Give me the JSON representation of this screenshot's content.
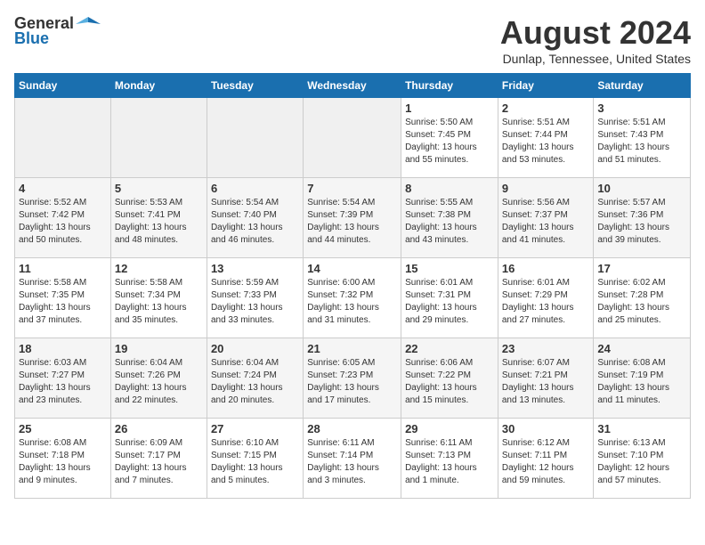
{
  "header": {
    "logo_general": "General",
    "logo_blue": "Blue",
    "month_year": "August 2024",
    "location": "Dunlap, Tennessee, United States"
  },
  "weekdays": [
    "Sunday",
    "Monday",
    "Tuesday",
    "Wednesday",
    "Thursday",
    "Friday",
    "Saturday"
  ],
  "weeks": [
    [
      {
        "day": "",
        "info": ""
      },
      {
        "day": "",
        "info": ""
      },
      {
        "day": "",
        "info": ""
      },
      {
        "day": "",
        "info": ""
      },
      {
        "day": "1",
        "info": "Sunrise: 5:50 AM\nSunset: 7:45 PM\nDaylight: 13 hours\nand 55 minutes."
      },
      {
        "day": "2",
        "info": "Sunrise: 5:51 AM\nSunset: 7:44 PM\nDaylight: 13 hours\nand 53 minutes."
      },
      {
        "day": "3",
        "info": "Sunrise: 5:51 AM\nSunset: 7:43 PM\nDaylight: 13 hours\nand 51 minutes."
      }
    ],
    [
      {
        "day": "4",
        "info": "Sunrise: 5:52 AM\nSunset: 7:42 PM\nDaylight: 13 hours\nand 50 minutes."
      },
      {
        "day": "5",
        "info": "Sunrise: 5:53 AM\nSunset: 7:41 PM\nDaylight: 13 hours\nand 48 minutes."
      },
      {
        "day": "6",
        "info": "Sunrise: 5:54 AM\nSunset: 7:40 PM\nDaylight: 13 hours\nand 46 minutes."
      },
      {
        "day": "7",
        "info": "Sunrise: 5:54 AM\nSunset: 7:39 PM\nDaylight: 13 hours\nand 44 minutes."
      },
      {
        "day": "8",
        "info": "Sunrise: 5:55 AM\nSunset: 7:38 PM\nDaylight: 13 hours\nand 43 minutes."
      },
      {
        "day": "9",
        "info": "Sunrise: 5:56 AM\nSunset: 7:37 PM\nDaylight: 13 hours\nand 41 minutes."
      },
      {
        "day": "10",
        "info": "Sunrise: 5:57 AM\nSunset: 7:36 PM\nDaylight: 13 hours\nand 39 minutes."
      }
    ],
    [
      {
        "day": "11",
        "info": "Sunrise: 5:58 AM\nSunset: 7:35 PM\nDaylight: 13 hours\nand 37 minutes."
      },
      {
        "day": "12",
        "info": "Sunrise: 5:58 AM\nSunset: 7:34 PM\nDaylight: 13 hours\nand 35 minutes."
      },
      {
        "day": "13",
        "info": "Sunrise: 5:59 AM\nSunset: 7:33 PM\nDaylight: 13 hours\nand 33 minutes."
      },
      {
        "day": "14",
        "info": "Sunrise: 6:00 AM\nSunset: 7:32 PM\nDaylight: 13 hours\nand 31 minutes."
      },
      {
        "day": "15",
        "info": "Sunrise: 6:01 AM\nSunset: 7:31 PM\nDaylight: 13 hours\nand 29 minutes."
      },
      {
        "day": "16",
        "info": "Sunrise: 6:01 AM\nSunset: 7:29 PM\nDaylight: 13 hours\nand 27 minutes."
      },
      {
        "day": "17",
        "info": "Sunrise: 6:02 AM\nSunset: 7:28 PM\nDaylight: 13 hours\nand 25 minutes."
      }
    ],
    [
      {
        "day": "18",
        "info": "Sunrise: 6:03 AM\nSunset: 7:27 PM\nDaylight: 13 hours\nand 23 minutes."
      },
      {
        "day": "19",
        "info": "Sunrise: 6:04 AM\nSunset: 7:26 PM\nDaylight: 13 hours\nand 22 minutes."
      },
      {
        "day": "20",
        "info": "Sunrise: 6:04 AM\nSunset: 7:24 PM\nDaylight: 13 hours\nand 20 minutes."
      },
      {
        "day": "21",
        "info": "Sunrise: 6:05 AM\nSunset: 7:23 PM\nDaylight: 13 hours\nand 17 minutes."
      },
      {
        "day": "22",
        "info": "Sunrise: 6:06 AM\nSunset: 7:22 PM\nDaylight: 13 hours\nand 15 minutes."
      },
      {
        "day": "23",
        "info": "Sunrise: 6:07 AM\nSunset: 7:21 PM\nDaylight: 13 hours\nand 13 minutes."
      },
      {
        "day": "24",
        "info": "Sunrise: 6:08 AM\nSunset: 7:19 PM\nDaylight: 13 hours\nand 11 minutes."
      }
    ],
    [
      {
        "day": "25",
        "info": "Sunrise: 6:08 AM\nSunset: 7:18 PM\nDaylight: 13 hours\nand 9 minutes."
      },
      {
        "day": "26",
        "info": "Sunrise: 6:09 AM\nSunset: 7:17 PM\nDaylight: 13 hours\nand 7 minutes."
      },
      {
        "day": "27",
        "info": "Sunrise: 6:10 AM\nSunset: 7:15 PM\nDaylight: 13 hours\nand 5 minutes."
      },
      {
        "day": "28",
        "info": "Sunrise: 6:11 AM\nSunset: 7:14 PM\nDaylight: 13 hours\nand 3 minutes."
      },
      {
        "day": "29",
        "info": "Sunrise: 6:11 AM\nSunset: 7:13 PM\nDaylight: 13 hours\nand 1 minute."
      },
      {
        "day": "30",
        "info": "Sunrise: 6:12 AM\nSunset: 7:11 PM\nDaylight: 12 hours\nand 59 minutes."
      },
      {
        "day": "31",
        "info": "Sunrise: 6:13 AM\nSunset: 7:10 PM\nDaylight: 12 hours\nand 57 minutes."
      }
    ]
  ]
}
